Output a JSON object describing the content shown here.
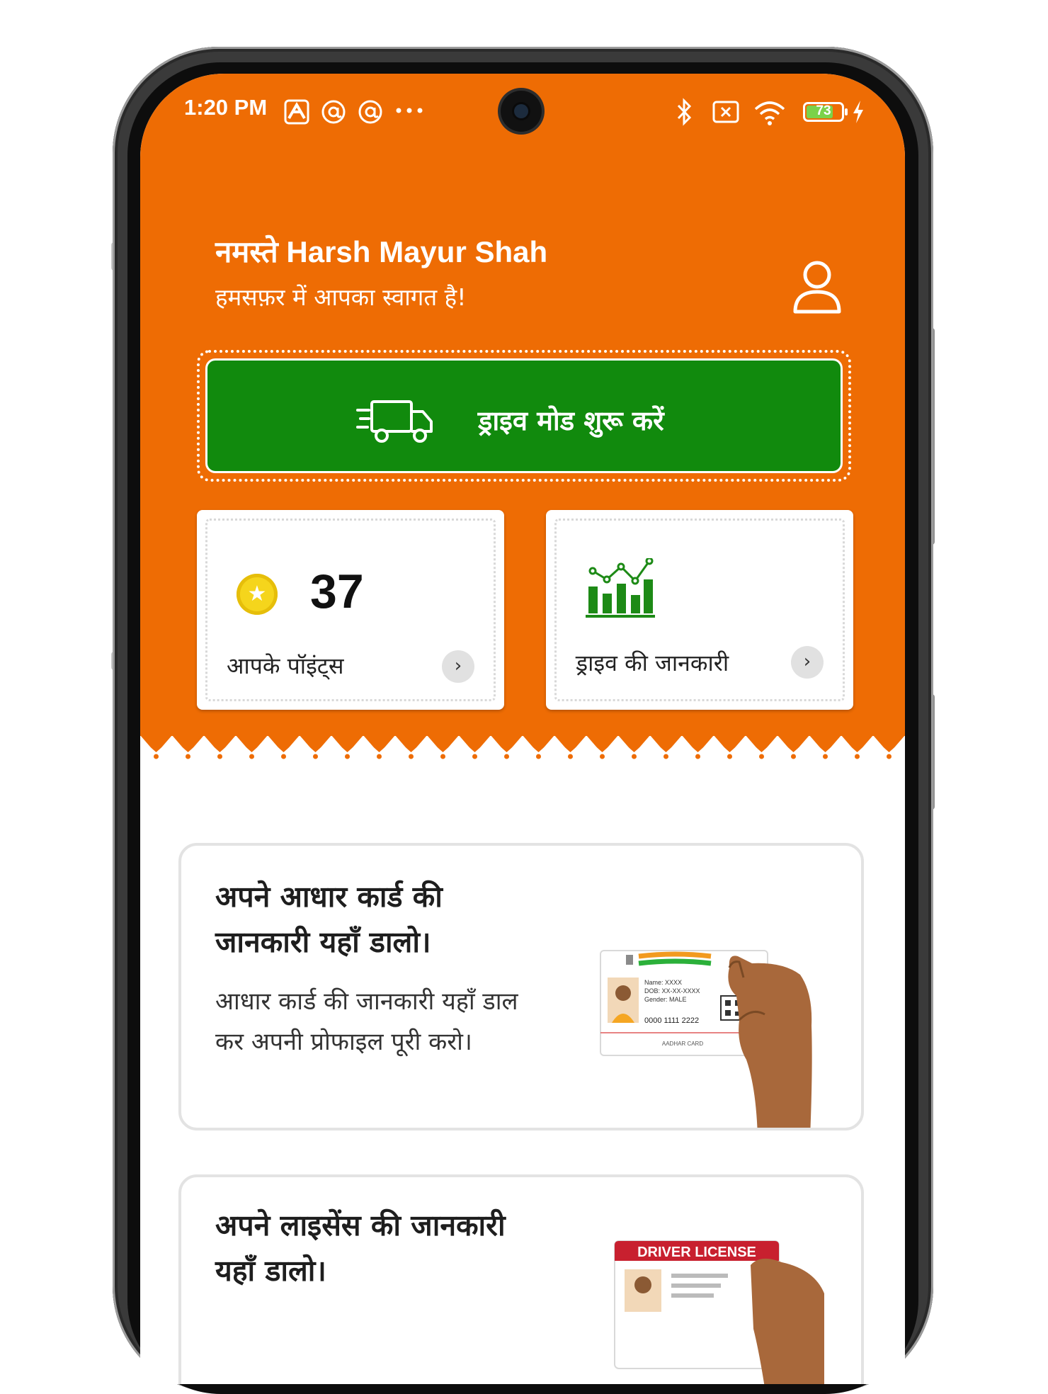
{
  "status_bar": {
    "time": "1:20 PM",
    "battery": "73",
    "icons": [
      "app-notification-icon",
      "at-sign-icon",
      "at-sign-icon",
      "more-dots-icon",
      "bluetooth-icon",
      "no-sim-icon",
      "wifi-icon",
      "battery-icon",
      "charging-icon"
    ]
  },
  "header": {
    "greeting": "नमस्ते Harsh Mayur Shah",
    "welcome": "हमसफ़र में आपका स्वागत है!"
  },
  "drive_button": {
    "label": "ड्राइव मोड शुरू करें"
  },
  "cards": {
    "points": {
      "value": "37",
      "label": "आपके पॉइंट्स"
    },
    "drive_info": {
      "label": "ड्राइव की जानकारी"
    }
  },
  "aadhar_card": {
    "title": "अपने आधार कार्ड की जानकारी यहाँ डालो।",
    "description": "आधार कार्ड की जानकारी यहाँ डाल कर अपनी प्रोफाइल पूरी करो।",
    "illustration": {
      "lines": [
        "Name: XXXX",
        "DOB: XX-XX-XXXX",
        "Gender: MALE"
      ],
      "number": "0000 1111 2222",
      "caption": "AADHAR CARD"
    }
  },
  "license_card": {
    "title": "अपने लाइसेंस की जानकारी यहाँ डालो।",
    "illustration": {
      "header": "DRIVER LICENSE"
    }
  },
  "colors": {
    "header_orange": "#ee6c04",
    "drive_green": "#118a0d",
    "chart_green": "#1d8a16",
    "coin_yellow": "#f5d51c"
  }
}
